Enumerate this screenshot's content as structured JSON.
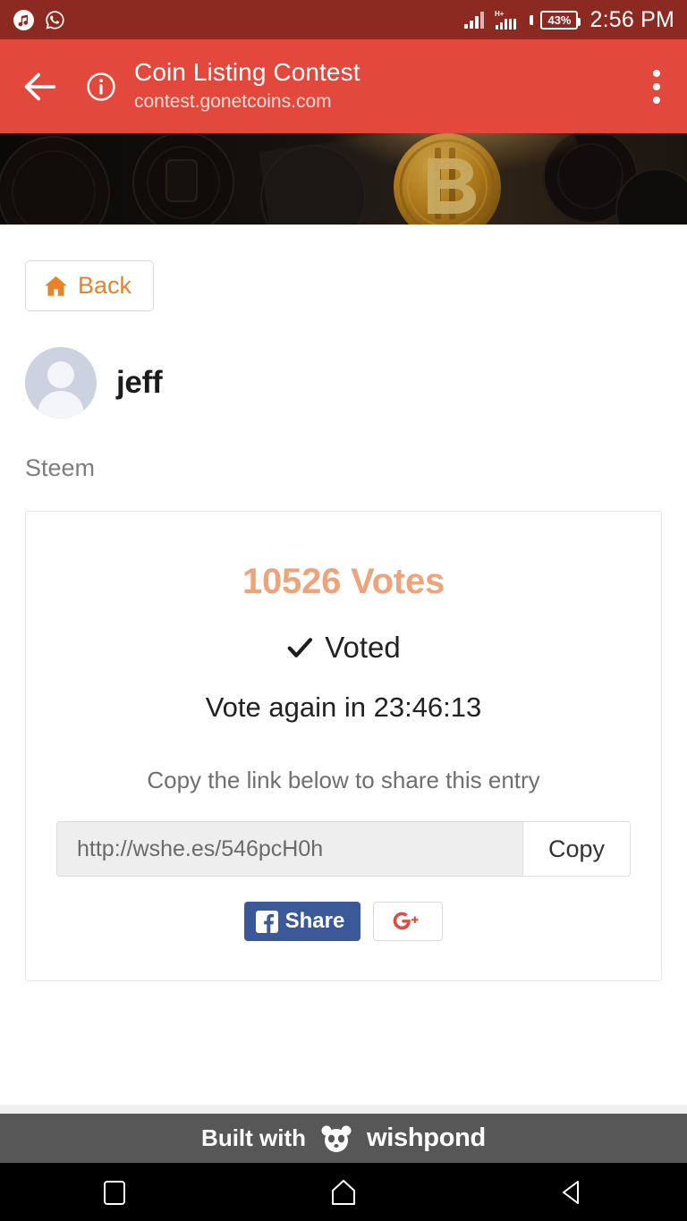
{
  "status_bar": {
    "notification_icons": [
      "music-note-icon",
      "whatsapp-icon"
    ],
    "signal_label": "H+",
    "battery_text": "43%",
    "time": "2:56 PM"
  },
  "app_bar": {
    "back_icon": "back-arrow-icon",
    "info_icon": "info-icon",
    "title": "Coin Listing Contest",
    "url": "contest.gonetcoins.com",
    "menu_icon": "overflow-menu-icon",
    "bg_color": "#e2483c"
  },
  "hero": {
    "alt": "cryptocurrency coins banner with bitcoin"
  },
  "page": {
    "back_button": {
      "icon": "home-icon",
      "label": "Back",
      "color": "#e8832a"
    },
    "profile": {
      "avatar_icon": "default-avatar-icon",
      "username": "jeff"
    },
    "coin_name": "Steem",
    "card": {
      "votes_text": "10526 Votes",
      "votes_color": "#eda37b",
      "voted_icon": "checkmark-icon",
      "voted_label": "Voted",
      "vote_again_text": "Vote again in 23:46:13",
      "share_hint": "Copy the link below to share this entry",
      "share_url": "http://wshe.es/546pcH0h",
      "copy_button_label": "Copy",
      "facebook": {
        "icon": "facebook-icon",
        "label": "Share",
        "color": "#3b5998"
      },
      "google_plus": {
        "icon": "google-plus-icon",
        "color": "#dc4e41"
      }
    }
  },
  "footer": {
    "built_with": "Built with",
    "logo_icon": "panda-icon",
    "brand": "wishpond",
    "bg_color": "#575757"
  },
  "nav_bar": {
    "recents_icon": "recents-square-icon",
    "home_icon": "home-pentagon-icon",
    "back_icon": "back-triangle-icon"
  }
}
